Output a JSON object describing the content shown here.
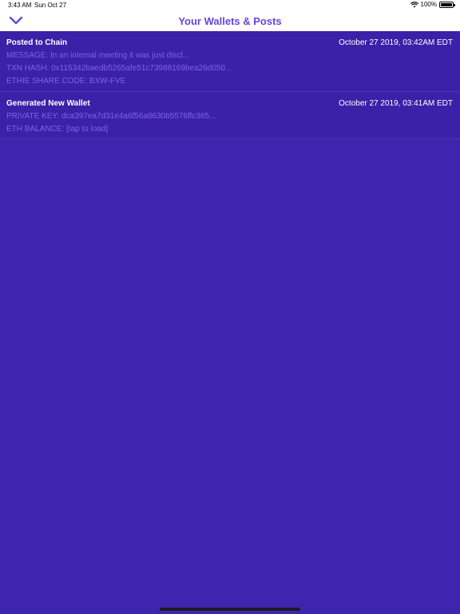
{
  "status_bar": {
    "time": "3:43 AM",
    "date": "Sun Oct 27",
    "battery": "100%",
    "wifi_icon": "wifi-icon",
    "battery_icon": "battery-icon"
  },
  "nav": {
    "title": "Your Wallets & Posts",
    "back_icon": "chevron-down-icon",
    "accent_color": "#6644dd"
  },
  "items": [
    {
      "title": "Posted to Chain",
      "timestamp": "October 27 2019, 03:42AM EDT",
      "lines": [
        "MESSAGE: In an internal meeting it was just discl...",
        "TXN HASH: 0x115342baedb5265afe51c73988169bea26d050...",
        "ETHIE SHARE CODE: BXW-FVE"
      ]
    },
    {
      "title": "Generated New Wallet",
      "timestamp": "October 27 2019, 03:41AM EDT",
      "lines": [
        "PRIVATE KEY: dca397ea7d31e4a6f56a8630b5576ffc365...",
        "ETH BALANCE: [tap to load]"
      ]
    }
  ],
  "colors": {
    "background": "#3f24b0",
    "row_background": "#3b20a8",
    "detail_text": "#7f63e8"
  }
}
